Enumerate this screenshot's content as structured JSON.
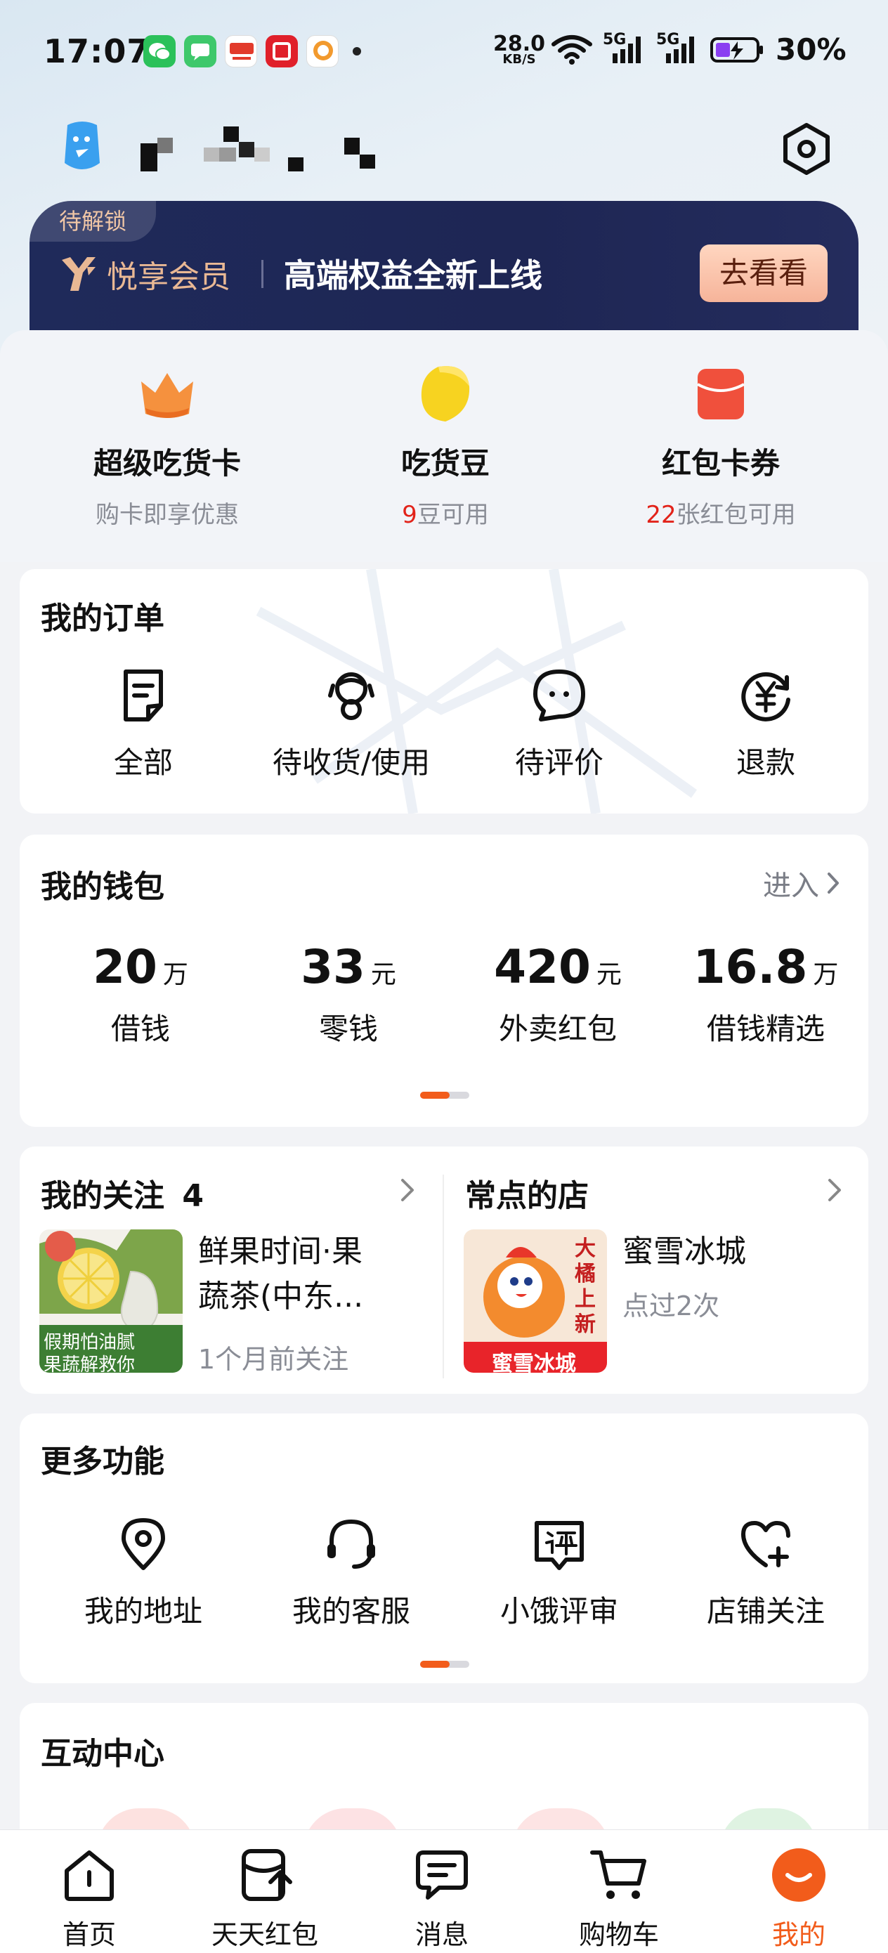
{
  "status_bar": {
    "time": "17:07",
    "net_speed_value": "28.0",
    "net_speed_unit": "KB/S",
    "network_1": "5G",
    "network_2": "5G",
    "battery_percent": "30%"
  },
  "member_banner": {
    "lock_tag": "待解锁",
    "name": "悦享会员",
    "promo": "高端权益全新上线",
    "cta": "去看看"
  },
  "benefits": [
    {
      "title": "超级吃货卡",
      "subtitle": "购卡即享优惠",
      "count": "",
      "count_suffix": ""
    },
    {
      "title": "吃货豆",
      "subtitle": "",
      "count": "9",
      "count_suffix": "豆可用"
    },
    {
      "title": "红包卡券",
      "subtitle": "",
      "count": "22",
      "count_suffix": "张红包可用"
    }
  ],
  "orders": {
    "title": "我的订单",
    "items": [
      "全部",
      "待收货/使用",
      "待评价",
      "退款"
    ]
  },
  "wallet": {
    "title": "我的钱包",
    "enter": "进入",
    "items": [
      {
        "value": "20",
        "unit": "万",
        "label": "借钱"
      },
      {
        "value": "33",
        "unit": "元",
        "label": "零钱"
      },
      {
        "value": "420",
        "unit": "元",
        "label": "外卖红包"
      },
      {
        "value": "16.8",
        "unit": "万",
        "label": "借钱精选"
      }
    ]
  },
  "follow": {
    "title": "我的关注",
    "count": "4",
    "shop_name": "鲜果时间·果蔬茶(中东...",
    "shop_name_line1": "鲜果时间·果",
    "shop_name_line2": "蔬茶(中东...",
    "meta": "1个月前关注",
    "thumb_text_1": "假期怕油腻",
    "thumb_text_2": "果蔬解救你"
  },
  "frequent": {
    "title": "常点的店",
    "shop_name": "蜜雪冰城",
    "meta": "点过2次",
    "thumb_text_vertical": "大橘上新",
    "thumb_brand": "蜜雪冰城"
  },
  "more": {
    "title": "更多功能",
    "items": [
      "我的地址",
      "我的客服",
      "小饿评审",
      "店铺关注"
    ]
  },
  "interaction": {
    "title": "互动中心"
  },
  "tab_bar": {
    "tabs": [
      "首页",
      "天天红包",
      "消息",
      "购物车",
      "我的"
    ],
    "active_index": 4
  },
  "colors": {
    "accent": "#f25c1b",
    "red": "#e2231a",
    "vip_dark": "#1f2a5a",
    "vip_gold": "#e9b894"
  }
}
